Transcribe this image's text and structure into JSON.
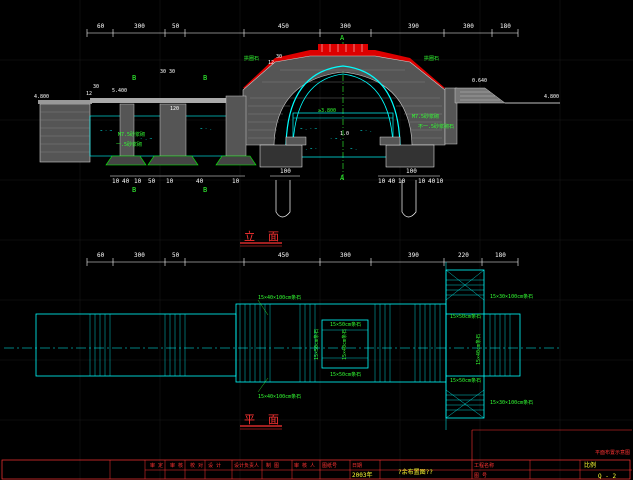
{
  "elevation": {
    "top_dims": [
      "60",
      "300",
      "50",
      "450",
      "300",
      "390",
      "300",
      "180"
    ],
    "left_level": "4.800",
    "right_level": "4.800",
    "pier_level": "5.400",
    "arch_top_level": "0.640",
    "dim_30a": "30",
    "dim_12a": "12",
    "dim_30b": "30",
    "dim_12b": "12",
    "mid_top": "30  30",
    "small_120": "120",
    "center_130": "130",
    "lower_water": "≥3.800",
    "lower_val": "1.0",
    "right_m75": "M7.5砂浆砌",
    "right_note": "不一.5砂浆砌石",
    "left_m75": "M7.5砂浆砌",
    "left_note": "一.5砂浆砌",
    "bottom_dims_left": [
      "10",
      "40",
      "10",
      "50",
      "10",
      "40",
      "10"
    ],
    "bottom_dims_mid": [
      "100"
    ],
    "bottom_dims_right": [
      "10",
      "40",
      "10",
      "100",
      "10",
      "40",
      "10"
    ],
    "section_a": "A",
    "section_b": "B",
    "arch_note": "拱圈石",
    "title_chars": [
      "立",
      "面"
    ]
  },
  "plan": {
    "top_dims": [
      "60",
      "300",
      "50",
      "450",
      "300",
      "390",
      "220",
      "180"
    ],
    "note_top": "15×40×100cm条石",
    "note_bottom": "15×40×100cm条石",
    "note_mid1": "15×50cm条石",
    "note_mid2": "15×50cm条石",
    "note_mid_v1": "15×50cm条石",
    "note_mid_v2": "15×40cm条石",
    "note_right1": "15×30×100cm条石",
    "note_right2": "15×30×100cm条石",
    "note_right_a": "15×50cm条石",
    "note_right_b": "15×50cm条石",
    "note_right_v": "15×40cm条石",
    "title_chars": [
      "平",
      "面"
    ]
  },
  "title_block": {
    "cells": [
      "审 定",
      "审 核",
      "校 对",
      "设 计",
      "设计负责人",
      "制 图",
      "审 核 人",
      "图纸号",
      "日期",
      "比例"
    ],
    "date": "2003年",
    "drawing_name": "?余布置图??",
    "right_label": "工程名称",
    "right_sub": "图 号",
    "sheet_no": "Q - 2",
    "stamp": "平面布置示意图"
  }
}
